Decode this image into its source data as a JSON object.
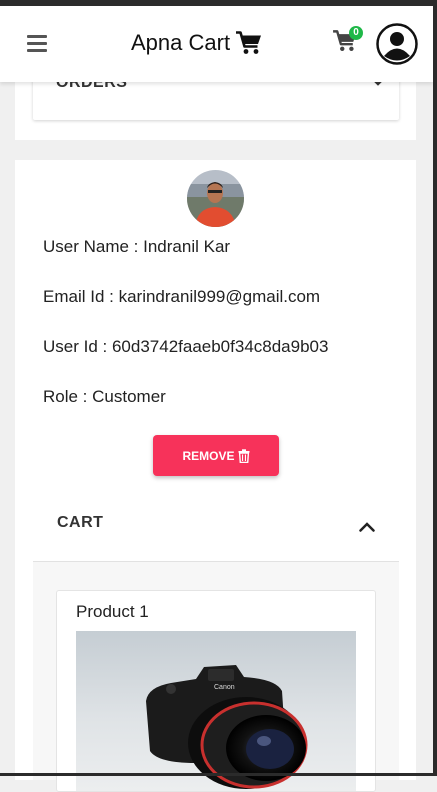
{
  "navbar": {
    "brand": "Apna Cart",
    "cart_count": "0"
  },
  "orders": {
    "label": "ORDERS"
  },
  "user": {
    "name_line": "User Name : Indranil Kar",
    "email_line": "Email Id : karindranil999@gmail.com",
    "id_line": "User Id : 60d3742faaeb0f34c8da9b03",
    "role_line": "Role : Customer",
    "remove_label": "REMOVE"
  },
  "cart": {
    "label": "CART",
    "products": [
      {
        "title": "Product 1"
      }
    ]
  },
  "colors": {
    "remove_button": "#f7325a",
    "cart_badge": "#1fb848",
    "page_background": "#f0f0f0"
  },
  "icons": [
    "hamburger-icon",
    "cart-icon",
    "account-icon",
    "chevron-up-icon",
    "chevron-down-icon",
    "trash-icon"
  ]
}
